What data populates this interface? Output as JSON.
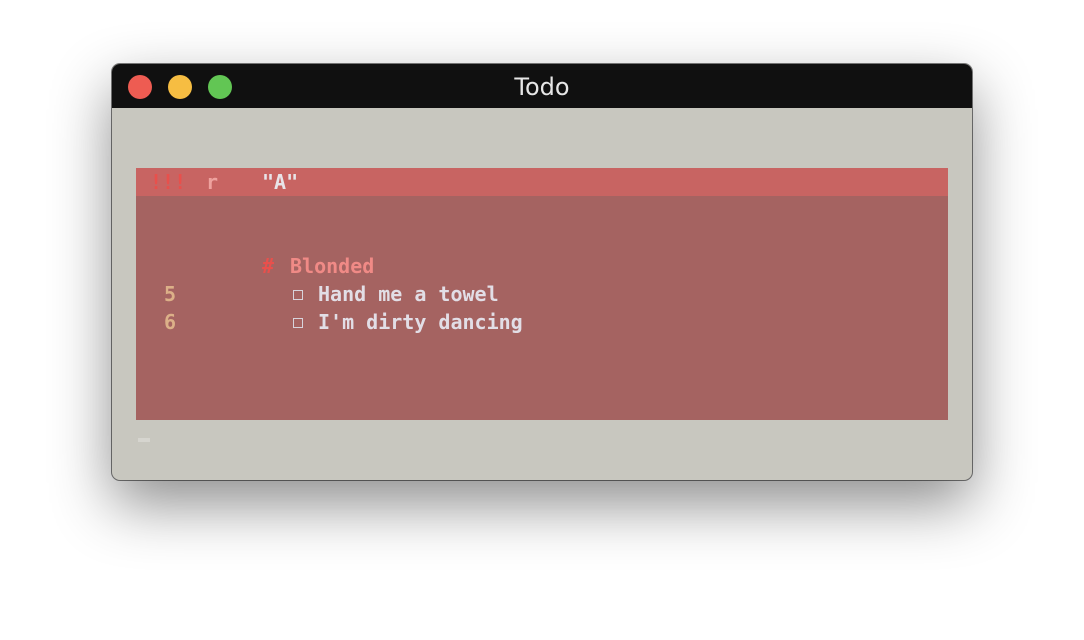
{
  "window": {
    "title": "Todo"
  },
  "colors": {
    "close": "#ee5c52",
    "minimize": "#f6bd42",
    "zoom": "#62c654"
  },
  "status_bar": {
    "priority": "!!!",
    "mode": "r",
    "register": "\"A\""
  },
  "list": {
    "heading_marker": "#",
    "heading": "Blonded",
    "items": [
      {
        "line": "5",
        "checkbox": "unchecked",
        "text": "Hand me a towel"
      },
      {
        "line": "6",
        "checkbox": "unchecked",
        "text": "I'm dirty dancing"
      }
    ]
  }
}
